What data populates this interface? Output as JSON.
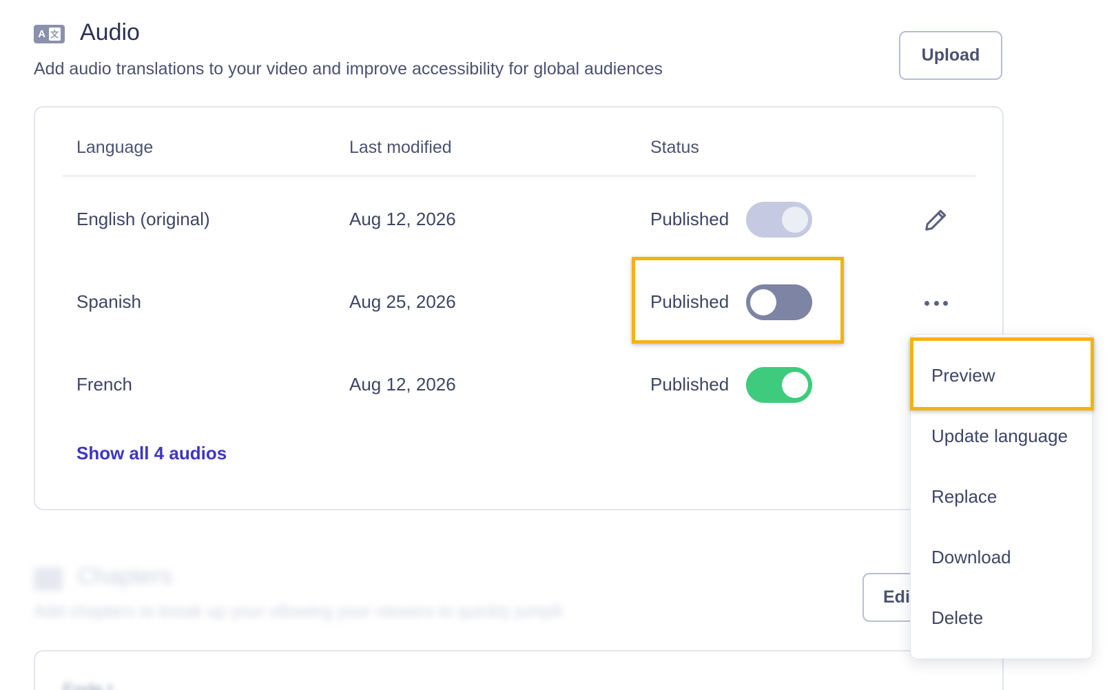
{
  "audio": {
    "title": "Audio",
    "description": "Add audio translations to your video and improve accessibility for global audiences",
    "upload_label": "Upload",
    "icon": "translate-icon"
  },
  "table": {
    "headers": [
      "Language",
      "Last modified",
      "Status"
    ],
    "rows": [
      {
        "language": "English (original)",
        "modified": "Aug 12, 2026",
        "status": "Published",
        "toggle": "disabled",
        "action": "pencil-icon"
      },
      {
        "language": "Spanish",
        "modified": "Aug 25, 2026",
        "status": "Published",
        "toggle": "off",
        "action": "more-icon"
      },
      {
        "language": "French",
        "modified": "Aug 12, 2026",
        "status": "Published",
        "toggle": "on",
        "action": ""
      }
    ],
    "show_all_label": "Show all 4 audios"
  },
  "menu": {
    "items": [
      "Preview",
      "Update language",
      "Replace",
      "Download",
      "Delete"
    ]
  },
  "chapters": {
    "title": "Chapters",
    "description": "Add chapters to break up your v8owing your viewers to quickly jump8",
    "edit_label": "Edit",
    "card_text": "Ende t"
  },
  "colors": {
    "accent": "#3e35c4",
    "toggle_on": "#3ecb7d",
    "toggle_off": "#7d84a4",
    "highlight": "#f2b313"
  }
}
